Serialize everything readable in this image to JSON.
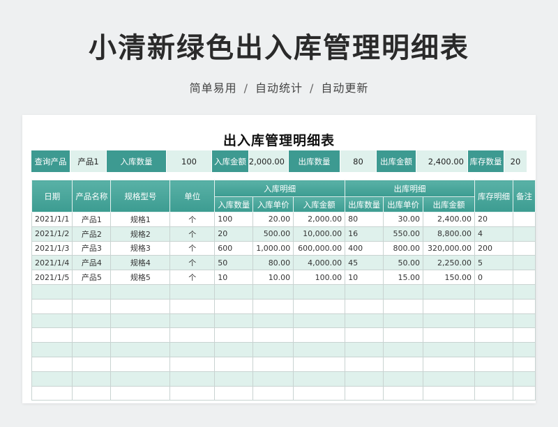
{
  "header": {
    "title": "小清新绿色出入库管理明细表",
    "subtitle_parts": [
      "简单易用",
      "自动统计",
      "自动更新"
    ],
    "separator": "/"
  },
  "sheet": {
    "title": "出入库管理明细表",
    "query": {
      "query_label": "查询产品",
      "query_value": "产品1",
      "in_qty_label": "入库数量",
      "in_qty_value": "100",
      "in_amount_label": "入库金额",
      "in_amount_value": "2,000.00",
      "out_qty_label": "出库数量",
      "out_qty_value": "80",
      "out_amount_label": "出库金额",
      "out_amount_value": "2,400.00",
      "stock_qty_label": "库存数量",
      "stock_qty_value": "20"
    },
    "table": {
      "headers": {
        "date": "日期",
        "product": "产品名称",
        "spec": "规格型号",
        "unit": "单位",
        "in_group": "入库明细",
        "out_group": "出库明细",
        "stock": "库存明细",
        "note": "备注",
        "in_qty": "入库数量",
        "in_price": "入库单价",
        "in_amount": "入库金额",
        "out_qty": "出库数量",
        "out_price": "出库单价",
        "out_amount": "出库金额"
      },
      "rows": [
        {
          "date": "2021/1/1",
          "product": "产品1",
          "spec": "规格1",
          "unit": "个",
          "in_qty": "100",
          "in_price": "20.00",
          "in_amount": "2,000.00",
          "out_qty": "80",
          "out_price": "30.00",
          "out_amount": "2,400.00",
          "stock": "20",
          "note": ""
        },
        {
          "date": "2021/1/2",
          "product": "产品2",
          "spec": "规格2",
          "unit": "个",
          "in_qty": "20",
          "in_price": "500.00",
          "in_amount": "10,000.00",
          "out_qty": "16",
          "out_price": "550.00",
          "out_amount": "8,800.00",
          "stock": "4",
          "note": ""
        },
        {
          "date": "2021/1/3",
          "product": "产品3",
          "spec": "规格3",
          "unit": "个",
          "in_qty": "600",
          "in_price": "1,000.00",
          "in_amount": "600,000.00",
          "out_qty": "400",
          "out_price": "800.00",
          "out_amount": "320,000.00",
          "stock": "200",
          "note": ""
        },
        {
          "date": "2021/1/4",
          "product": "产品4",
          "spec": "规格4",
          "unit": "个",
          "in_qty": "50",
          "in_price": "80.00",
          "in_amount": "4,000.00",
          "out_qty": "45",
          "out_price": "50.00",
          "out_amount": "2,250.00",
          "stock": "5",
          "note": ""
        },
        {
          "date": "2021/1/5",
          "product": "产品5",
          "spec": "规格5",
          "unit": "个",
          "in_qty": "10",
          "in_price": "10.00",
          "in_amount": "100.00",
          "out_qty": "10",
          "out_price": "15.00",
          "out_amount": "150.00",
          "stock": "0",
          "note": ""
        },
        {
          "date": "",
          "product": "",
          "spec": "",
          "unit": "",
          "in_qty": "",
          "in_price": "",
          "in_amount": "",
          "out_qty": "",
          "out_price": "",
          "out_amount": "",
          "stock": "",
          "note": ""
        },
        {
          "date": "",
          "product": "",
          "spec": "",
          "unit": "",
          "in_qty": "",
          "in_price": "",
          "in_amount": "",
          "out_qty": "",
          "out_price": "",
          "out_amount": "",
          "stock": "",
          "note": ""
        },
        {
          "date": "",
          "product": "",
          "spec": "",
          "unit": "",
          "in_qty": "",
          "in_price": "",
          "in_amount": "",
          "out_qty": "",
          "out_price": "",
          "out_amount": "",
          "stock": "",
          "note": ""
        },
        {
          "date": "",
          "product": "",
          "spec": "",
          "unit": "",
          "in_qty": "",
          "in_price": "",
          "in_amount": "",
          "out_qty": "",
          "out_price": "",
          "out_amount": "",
          "stock": "",
          "note": ""
        },
        {
          "date": "",
          "product": "",
          "spec": "",
          "unit": "",
          "in_qty": "",
          "in_price": "",
          "in_amount": "",
          "out_qty": "",
          "out_price": "",
          "out_amount": "",
          "stock": "",
          "note": ""
        },
        {
          "date": "",
          "product": "",
          "spec": "",
          "unit": "",
          "in_qty": "",
          "in_price": "",
          "in_amount": "",
          "out_qty": "",
          "out_price": "",
          "out_amount": "",
          "stock": "",
          "note": ""
        },
        {
          "date": "",
          "product": "",
          "spec": "",
          "unit": "",
          "in_qty": "",
          "in_price": "",
          "in_amount": "",
          "out_qty": "",
          "out_price": "",
          "out_amount": "",
          "stock": "",
          "note": ""
        },
        {
          "date": "",
          "product": "",
          "spec": "",
          "unit": "",
          "in_qty": "",
          "in_price": "",
          "in_amount": "",
          "out_qty": "",
          "out_price": "",
          "out_amount": "",
          "stock": "",
          "note": ""
        }
      ]
    }
  },
  "colors": {
    "accent": "#3d9a91",
    "row_alt": "#dff1ec",
    "background": "#eef0f1"
  }
}
